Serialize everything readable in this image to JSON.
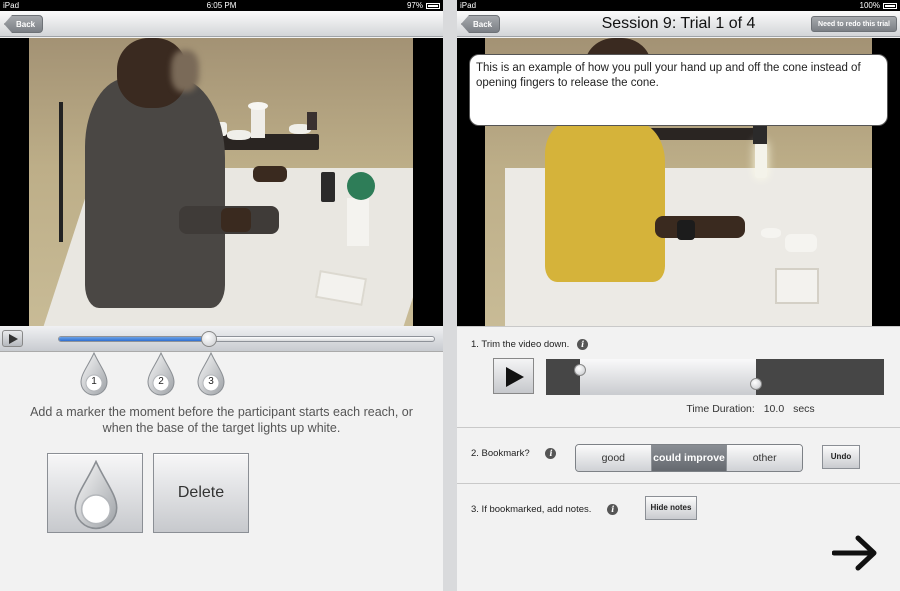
{
  "left": {
    "status": {
      "carrier": "iPad",
      "time": "6:05 PM",
      "battery": "97%",
      "battery_level": 0.97
    },
    "back_label": "Back",
    "seek_progress": 0.4,
    "markers": [
      {
        "label": "1"
      },
      {
        "label": "2"
      },
      {
        "label": "3"
      }
    ],
    "instructions": "Add a marker the moment before the participant starts each reach, or when the base of the target lights up white.",
    "delete_label": "Delete"
  },
  "right": {
    "status": {
      "carrier": "iPad",
      "time": "",
      "battery": "100%",
      "battery_level": 1.0
    },
    "back_label": "Back",
    "title": "Session 9: Trial 1 of 4",
    "redo_label": "Need to redo this trial",
    "callout": "This is an example of how you pull your hand up and off the cone instead of opening fingers to release the cone.",
    "trim": {
      "label": "1. Trim the video down.",
      "start": 0.1,
      "end": 0.62
    },
    "duration": {
      "label": "Time Duration:",
      "value": "10.0",
      "unit": "secs"
    },
    "bookmark": {
      "label": "2. Bookmark?",
      "options": [
        "good",
        "could improve",
        "other"
      ],
      "selected": "could improve",
      "undo_label": "Undo"
    },
    "notes": {
      "label": "3. If bookmarked, add notes.",
      "hide_label": "Hide notes"
    },
    "info_glyph": "i"
  }
}
